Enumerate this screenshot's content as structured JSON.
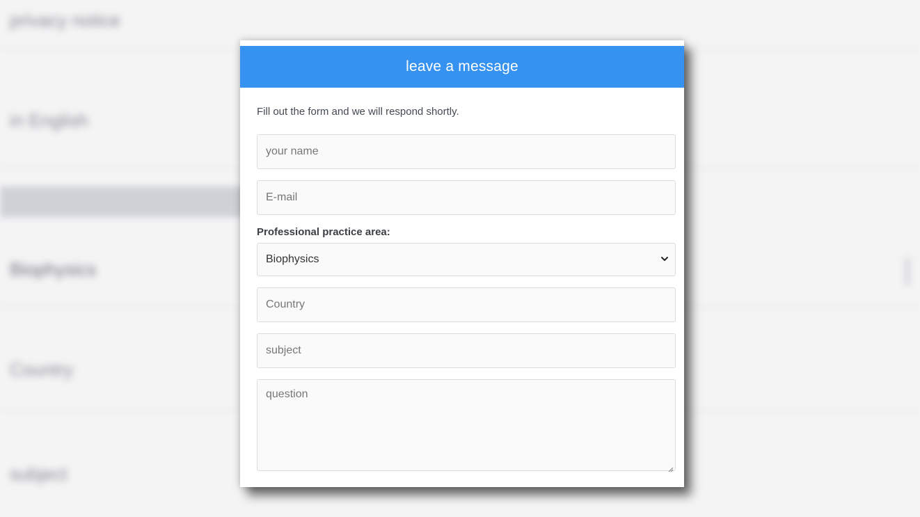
{
  "background": {
    "text_1": "privacy notice",
    "text_2": "in English",
    "text_3": "Biophysics",
    "text_4": "Country",
    "text_5": "subject"
  },
  "modal": {
    "title": "leave a message",
    "intro": "Fill out the form and we will respond shortly.",
    "name_placeholder": "your name",
    "email_placeholder": "E-mail",
    "practice_label": "Professional practice area:",
    "practice_selected": "Biophysics",
    "country_placeholder": "Country",
    "subject_placeholder": "subject",
    "question_placeholder": "question"
  },
  "colors": {
    "header_bg": "#3592f0",
    "header_text": "#ffffff"
  },
  "icons": {
    "select_arrow": "chevron-down-icon",
    "resize_handle": "resize-grip-icon"
  }
}
